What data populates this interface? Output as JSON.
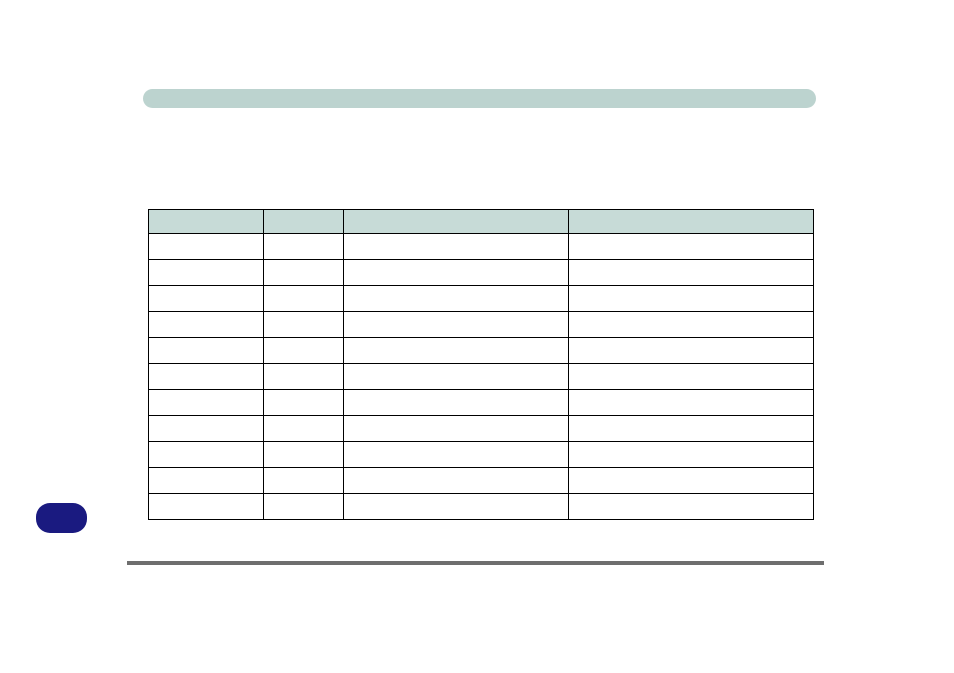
{
  "header": {
    "title": ""
  },
  "table": {
    "headers": [
      "",
      "",
      "",
      ""
    ],
    "rows": [
      [
        "",
        "",
        "",
        ""
      ],
      [
        "",
        "",
        "",
        ""
      ],
      [
        "",
        "",
        "",
        ""
      ],
      [
        "",
        "",
        "",
        ""
      ],
      [
        "",
        "",
        "",
        ""
      ],
      [
        "",
        "",
        "",
        ""
      ],
      [
        "",
        "",
        "",
        ""
      ],
      [
        "",
        "",
        "",
        ""
      ],
      [
        "",
        "",
        "",
        ""
      ],
      [
        "",
        "",
        "",
        ""
      ],
      [
        "",
        "",
        "",
        ""
      ]
    ]
  },
  "page_badge": {
    "label": ""
  },
  "colors": {
    "header_bar": "#bcd3cf",
    "table_header": "#c7dbd7",
    "badge": "#1a1a80",
    "footer_rule": "#6e6e6e"
  }
}
